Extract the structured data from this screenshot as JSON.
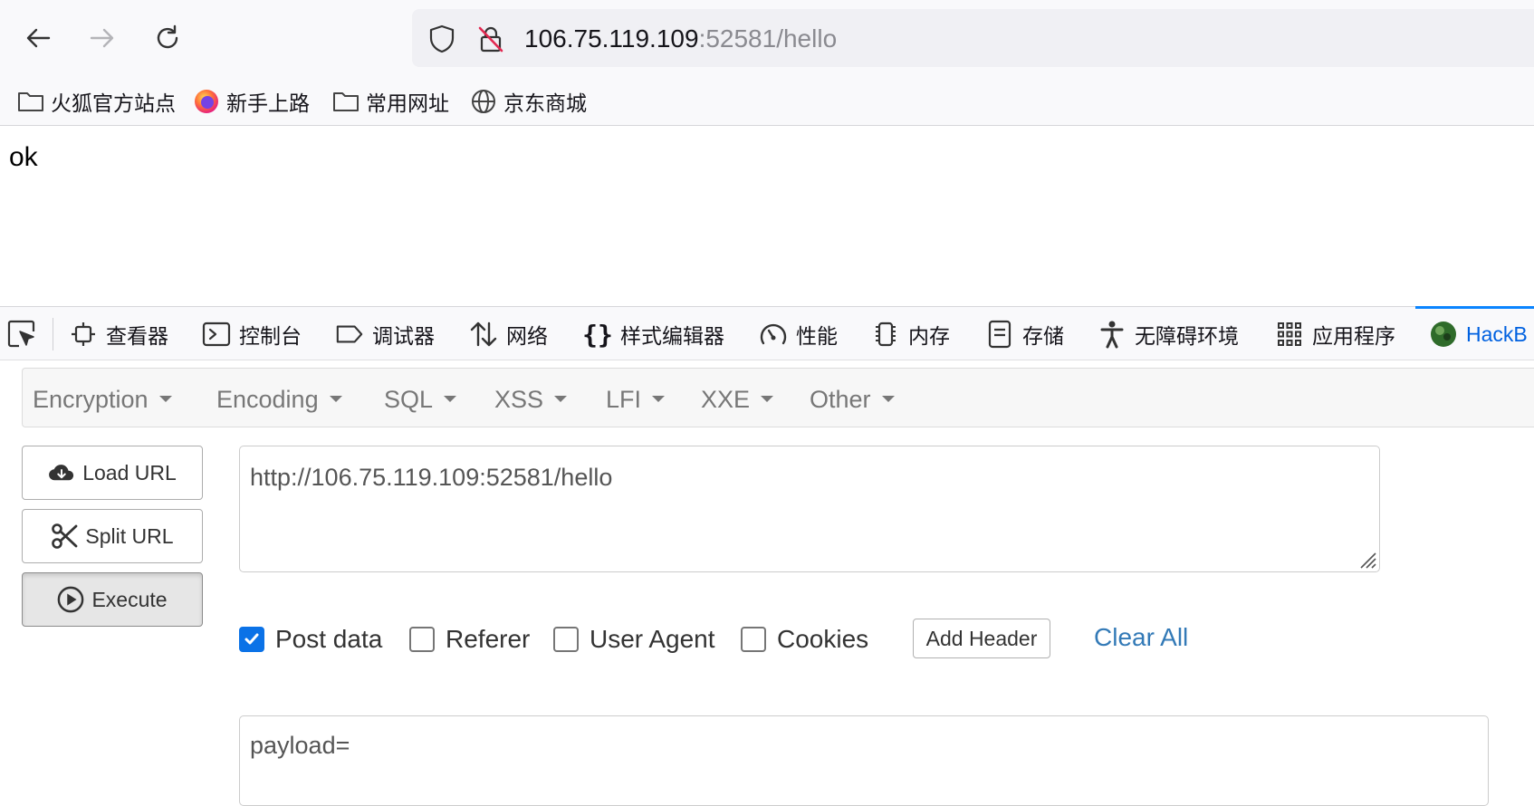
{
  "browser": {
    "url_host": "106.75.119.109",
    "url_rest": ":52581/hello",
    "bookmarks": [
      {
        "label": "火狐官方站点",
        "icon": "folder-icon"
      },
      {
        "label": "新手上路",
        "icon": "firefox-logo-icon"
      },
      {
        "label": "常用网址",
        "icon": "folder-icon"
      },
      {
        "label": "京东商城",
        "icon": "globe-icon"
      }
    ]
  },
  "page": {
    "body_text": "ok"
  },
  "devtools": {
    "tabs": [
      {
        "label": "查看器",
        "icon": "inspector-icon"
      },
      {
        "label": "控制台",
        "icon": "console-icon"
      },
      {
        "label": "调试器",
        "icon": "debugger-icon"
      },
      {
        "label": "网络",
        "icon": "network-icon"
      },
      {
        "label": "样式编辑器",
        "icon": "style-editor-icon"
      },
      {
        "label": "性能",
        "icon": "performance-icon"
      },
      {
        "label": "内存",
        "icon": "memory-icon"
      },
      {
        "label": "存储",
        "icon": "storage-icon"
      },
      {
        "label": "无障碍环境",
        "icon": "accessibility-icon"
      },
      {
        "label": "应用程序",
        "icon": "application-icon"
      },
      {
        "label": "HackB",
        "icon": "hackbar-icon",
        "active": true
      }
    ]
  },
  "hackbar": {
    "menu": [
      "Encryption",
      "Encoding",
      "SQL",
      "XSS",
      "LFI",
      "XXE",
      "Other"
    ],
    "load_url_label": "Load URL",
    "split_url_label": "Split URL",
    "execute_label": "Execute",
    "url_value": "http://106.75.119.109:52581/hello",
    "options": [
      {
        "label": "Post data",
        "checked": true
      },
      {
        "label": "Referer",
        "checked": false
      },
      {
        "label": "User Agent",
        "checked": false
      },
      {
        "label": "Cookies",
        "checked": false
      }
    ],
    "add_header_label": "Add Header",
    "clear_all_label": "Clear All",
    "post_data_value": "payload="
  },
  "colors": {
    "accent": "#0b72e7",
    "active_tab": "#0061e0",
    "link": "#337ab7"
  }
}
